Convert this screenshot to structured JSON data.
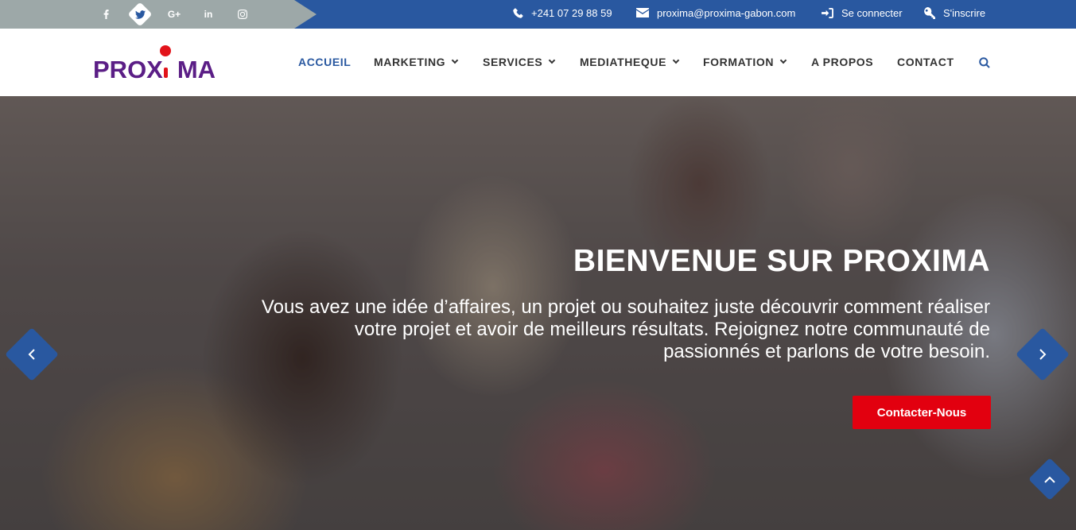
{
  "topbar": {
    "social": [
      {
        "name": "facebook-icon",
        "glyph": "f"
      },
      {
        "name": "twitter-icon",
        "glyph": "twitter"
      },
      {
        "name": "google-plus-icon",
        "glyph": "G+"
      },
      {
        "name": "linkedin-icon",
        "glyph": "in"
      },
      {
        "name": "instagram-icon",
        "glyph": "instagram"
      }
    ],
    "phone": "+241 07 29 88 59",
    "email": "proxima@proxima-gabon.com",
    "login": "Se connecter",
    "register": "S'inscrire"
  },
  "brand": {
    "logo_text": "PROXIMA",
    "colors": {
      "primary": "#2958a0",
      "accent": "#e2000f",
      "logo": "#5b1e86"
    }
  },
  "nav": {
    "items": [
      {
        "label": "ACCUEIL",
        "active": true,
        "dropdown": false
      },
      {
        "label": "MARKETING",
        "active": false,
        "dropdown": true
      },
      {
        "label": "SERVICES",
        "active": false,
        "dropdown": true
      },
      {
        "label": "MEDIATHEQUE",
        "active": false,
        "dropdown": true
      },
      {
        "label": "FORMATION",
        "active": false,
        "dropdown": true
      },
      {
        "label": "A PROPOS",
        "active": false,
        "dropdown": false
      },
      {
        "label": "CONTACT",
        "active": false,
        "dropdown": false
      }
    ]
  },
  "hero": {
    "title": "BIENVENUE SUR PROXIMA",
    "text": "Vous avez une idée d’affaires, un projet ou souhaitez juste découvrir comment réaliser votre projet et avoir de meilleurs résultats. Rejoignez notre communauté de passionnés et parlons de votre besoin.",
    "cta": "Contacter-Nous"
  }
}
